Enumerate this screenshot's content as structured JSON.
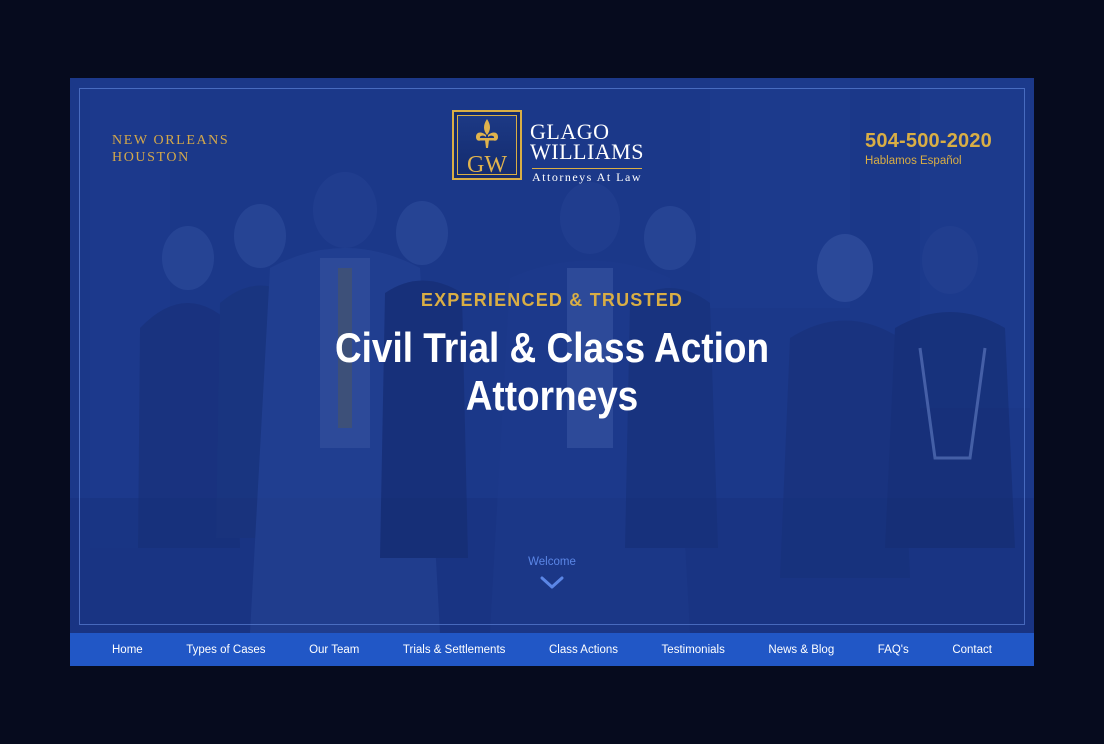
{
  "header": {
    "locations": [
      "NEW ORLEANS",
      "HOUSTON"
    ],
    "logo": {
      "monogram": "GW",
      "name_line1": "GLAGO",
      "name_line2": "WILLIAMS",
      "tagline": "Attorneys At Law",
      "icon": "fleur-de-lis-icon"
    },
    "phone": "504-500-2020",
    "phone_note": "Hablamos Español"
  },
  "hero": {
    "eyebrow": "EXPERIENCED & TRUSTED",
    "headline_line1": "Civil Trial & Class Action",
    "headline_line2": "Attorneys",
    "scroll_label": "Welcome",
    "scroll_icon": "chevron-down-icon"
  },
  "nav": {
    "items": [
      "Home",
      "Types of Cases",
      "Our Team",
      "Trials & Settlements",
      "Class Actions",
      "Testimonials",
      "News & Blog",
      "FAQ's",
      "Contact"
    ]
  },
  "colors": {
    "page_background": "#060b1e",
    "hero_overlay": "#1c3a8c",
    "accent_gold": "#d9ae45",
    "nav_background": "#2157c6",
    "scroll_blue": "#5b86e6"
  }
}
